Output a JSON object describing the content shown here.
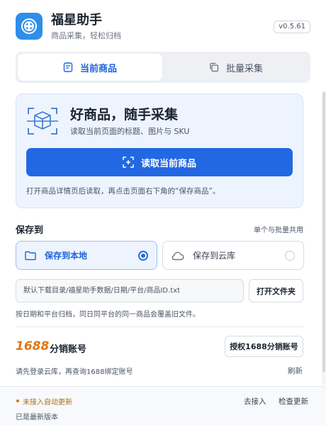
{
  "app": {
    "title": "福星助手",
    "subtitle": "商品采集，轻松归档",
    "version": "v0.5.61"
  },
  "tabs": [
    {
      "label": "当前商品",
      "icon": "document-icon",
      "active": true
    },
    {
      "label": "批量采集",
      "icon": "copy-icon",
      "active": false
    }
  ],
  "hero": {
    "title": "好商品，随手采集",
    "desc": "读取当前页面的标题、图片与 SKU",
    "button_label": "读取当前商品",
    "hint": "打开商品详情页后读取，再点击页面右下角的“保存商品”。"
  },
  "save": {
    "title": "保存到",
    "note": "单个与批量共用",
    "options": [
      {
        "label": "保存到本地",
        "icon": "folder-icon",
        "selected": true
      },
      {
        "label": "保存到云库",
        "icon": "cloud-icon",
        "selected": false
      }
    ],
    "path_value": "默认下载目录/福星助手数据/日期/平台/商品ID.txt",
    "open_folder_label": "打开文件夹",
    "path_hint": "按日期和平台归档，同日同平台的同一商品会覆盖旧文件。"
  },
  "account": {
    "number": "1688",
    "label": "分销账号",
    "auth_button": "授权1688分销账号",
    "hint": "请先登录云库，再查询1688绑定账号",
    "refresh_label": "刷新"
  },
  "footer": {
    "status": "未接入自动更新",
    "connect_label": "去接入",
    "check_label": "检查更新",
    "latest": "已是最新版本"
  },
  "colors": {
    "primary": "#2268e3",
    "brand": "#2f8ee8",
    "accent_orange": "#e07515",
    "status_warn": "#b36b0e"
  }
}
